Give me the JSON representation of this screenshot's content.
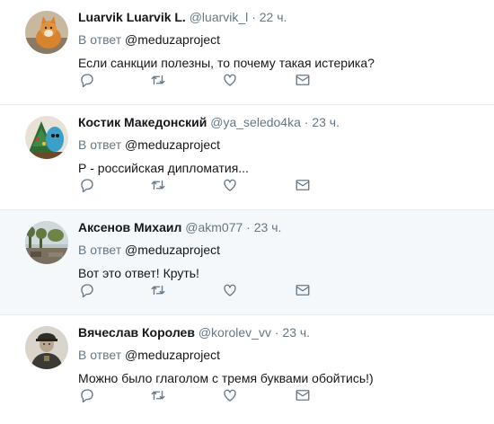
{
  "tweets": [
    {
      "fullname": "Luarvik Luarvik L.",
      "username": "@luarvik_l",
      "separator": "·",
      "time": "22 ч.",
      "reply_prefix": "В ответ",
      "reply_mention": "@meduzaproject",
      "text": "Если санкции полезны, то почему такая истерика?",
      "avatar_icon": "cat-photo-avatar"
    },
    {
      "fullname": "Костик Македонский",
      "username": "@ya_seledo4ka",
      "separator": "·",
      "time": "23 ч.",
      "reply_prefix": "В ответ",
      "reply_mention": "@meduzaproject",
      "text": "Р - российская дипломатия...",
      "avatar_icon": "tree-photo-avatar"
    },
    {
      "fullname": "Аксенов Михаил",
      "username": "@akm077",
      "separator": "·",
      "time": "23 ч.",
      "reply_prefix": "В ответ",
      "reply_mention": "@meduzaproject",
      "text": "Вот это ответ! Круть!",
      "avatar_icon": "landscape-photo-avatar"
    },
    {
      "fullname": "Вячеслав Королев",
      "username": "@korolev_vv",
      "separator": "·",
      "time": "23 ч.",
      "reply_prefix": "В ответ",
      "reply_mention": "@meduzaproject",
      "text": "Можно было глаголом с тремя буквами обойтись!)",
      "avatar_icon": "portrait-photo-avatar"
    }
  ],
  "colors": {
    "text": "#14171a",
    "muted": "#657786",
    "divider": "#e6ecf0",
    "hover_bg": "#f5f8fa"
  },
  "icons": [
    "reply-icon",
    "retweet-icon",
    "like-icon",
    "direct-message-icon"
  ]
}
